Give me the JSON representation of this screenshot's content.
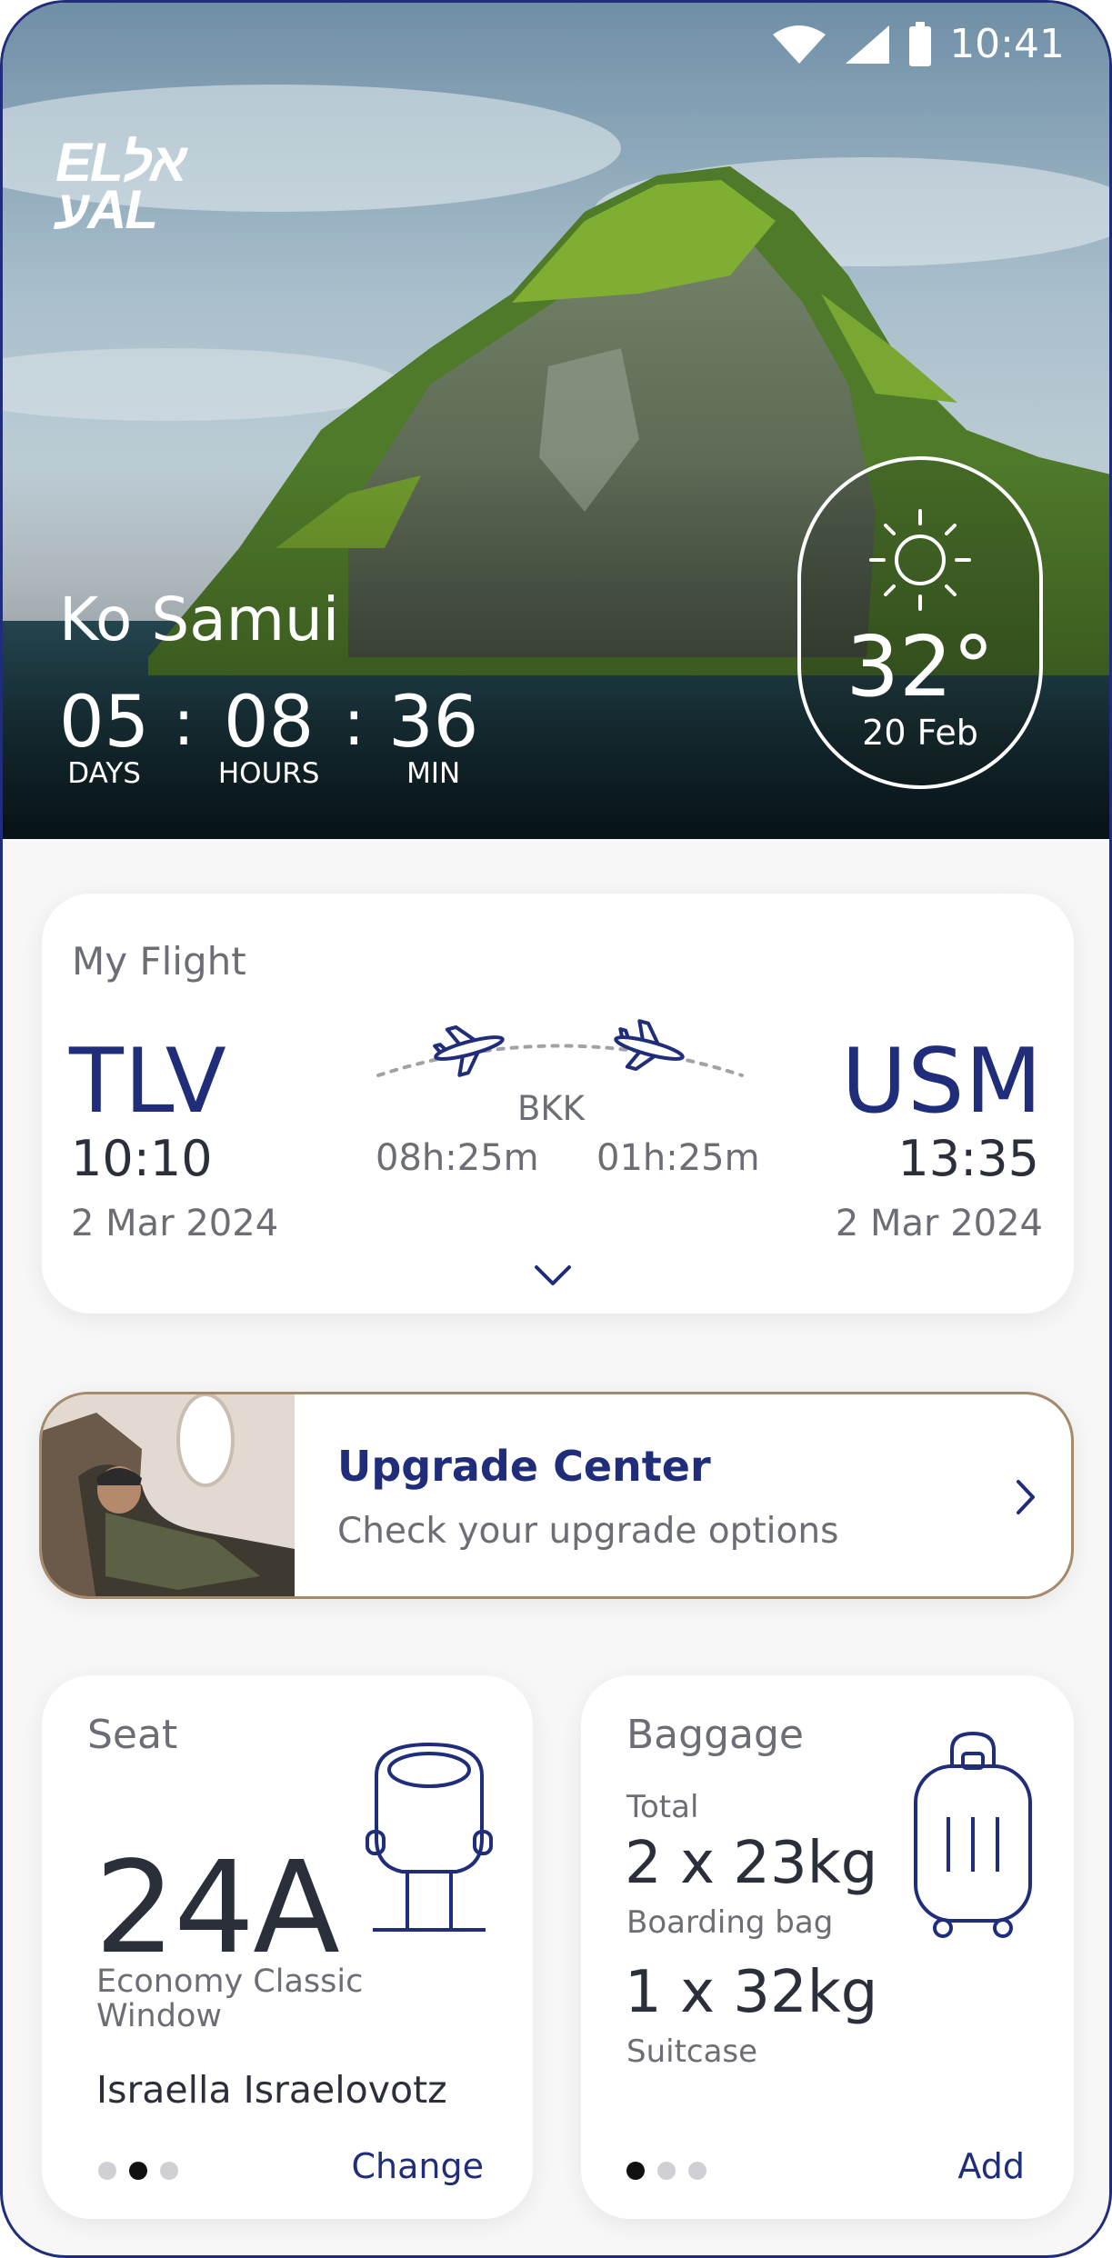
{
  "status_bar": {
    "time": "10:41",
    "icons": [
      "wifi-icon",
      "signal-icon",
      "battery-icon"
    ]
  },
  "hero": {
    "logo_line1": "ELאל",
    "logo_line2": "עAL",
    "destination": "Ko Samui",
    "countdown": {
      "days": "05",
      "days_label": "DAYS",
      "hours": "08",
      "hours_label": "HOURS",
      "minutes": "36",
      "minutes_label": "MIN",
      "separator": ":"
    },
    "weather": {
      "icon": "sun-icon",
      "temperature": "32°",
      "date": "20 Feb"
    }
  },
  "flight": {
    "title": "My Flight",
    "origin": {
      "code": "TLV",
      "time": "10:10",
      "date": "2 Mar 2024"
    },
    "destination": {
      "code": "USM",
      "time": "13:35",
      "date": "2 Mar 2024"
    },
    "stopover": "BKK",
    "leg1_duration": "08h:25m",
    "leg2_duration": "01h:25m"
  },
  "upgrade": {
    "title": "Upgrade Center",
    "subtitle": "Check your upgrade options"
  },
  "seat": {
    "title": "Seat",
    "number": "24A",
    "class_line1": "Economy Classic",
    "class_line2": "Window",
    "passenger": "Israella Israelovotz",
    "action": "Change",
    "active_page": 1
  },
  "baggage": {
    "title": "Baggage",
    "total_label": "Total",
    "items": [
      {
        "quantity": "2 x 23kg",
        "label": "Boarding bag"
      },
      {
        "quantity": "1 x 32kg",
        "label": "Suitcase"
      }
    ],
    "action": "Add",
    "active_page": 0
  },
  "colors": {
    "brand_blue": "#1f2d7a",
    "gold_border": "#a48a6a"
  }
}
